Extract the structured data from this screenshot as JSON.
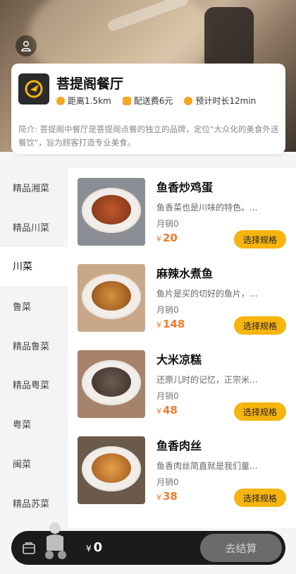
{
  "shop": {
    "name": "菩提阁餐厅",
    "distance": "距离1.5km",
    "delivery_fee": "配送费6元",
    "eta": "预计时长12min",
    "description": "简介: 菩提阁中餐厅是菩提阁点餐的独立的品牌，定位\"大众化的美食外送餐饮\"，旨为顾客打造专业美食。"
  },
  "categories": [
    {
      "label": "精品湘菜",
      "active": false
    },
    {
      "label": "精品川菜",
      "active": false
    },
    {
      "label": "川菜",
      "active": true
    },
    {
      "label": "鲁菜",
      "active": false
    },
    {
      "label": "精品鲁菜",
      "active": false
    },
    {
      "label": "精品粤菜",
      "active": false
    },
    {
      "label": "粤菜",
      "active": false
    },
    {
      "label": "闽菜",
      "active": false
    },
    {
      "label": "精品苏菜",
      "active": false
    }
  ],
  "dishes": [
    {
      "name": "鱼香炒鸡蛋",
      "desc": "鱼香菜也是川味的特色。...",
      "sales": "月销0",
      "currency": "¥",
      "price": "20",
      "button": "选择规格"
    },
    {
      "name": "麻辣水煮鱼",
      "desc": "鱼片是买的切好的鱼片，...",
      "sales": "月销0",
      "currency": "¥",
      "price": "148",
      "button": "选择规格"
    },
    {
      "name": "大米凉糕",
      "desc": "还原儿时的记忆，正宗米...",
      "sales": "月销0",
      "currency": "¥",
      "price": "48",
      "button": "选择规格"
    },
    {
      "name": "鱼香肉丝",
      "desc": "鱼香肉丝简直就是我们童...",
      "sales": "月销0",
      "currency": "¥",
      "price": "38",
      "button": "选择规格"
    }
  ],
  "cart": {
    "currency": "¥",
    "total": "0",
    "checkout_label": "去结算"
  },
  "colors": {
    "accent": "#f6b40e",
    "price": "#f07b2b",
    "cart_bar": "#1b1b1b"
  }
}
